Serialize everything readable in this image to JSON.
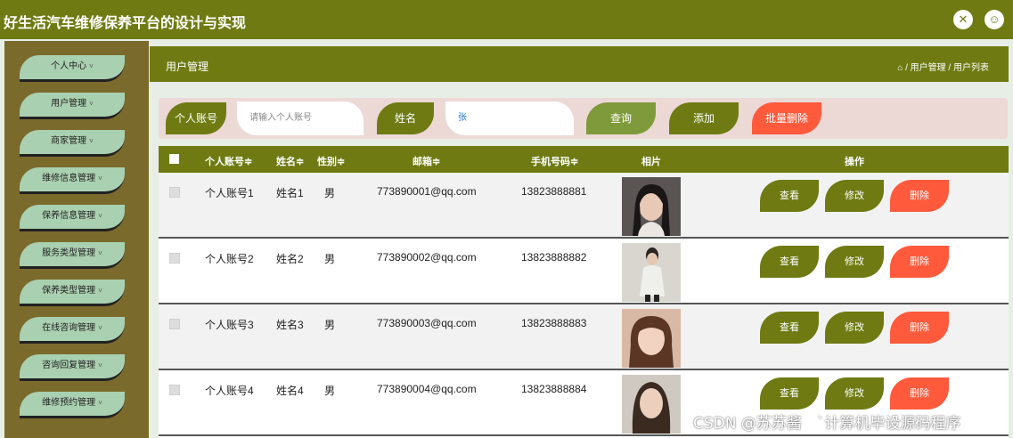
{
  "app": {
    "title": "好生活汽车维修保养平台的设计与实现"
  },
  "topbar": {
    "fullscreen_icon": "fullscreen-icon",
    "user_icon": "user-icon"
  },
  "sidebar": {
    "items": [
      {
        "label": "个人中心"
      },
      {
        "label": "用户管理"
      },
      {
        "label": "商家管理"
      },
      {
        "label": "维修信息管理"
      },
      {
        "label": "保养信息管理"
      },
      {
        "label": "服务类型管理"
      },
      {
        "label": "保养类型管理"
      },
      {
        "label": "在线咨询管理"
      },
      {
        "label": "咨询回复管理"
      },
      {
        "label": "维修预约管理"
      }
    ],
    "chevron": "˅"
  },
  "header": {
    "title": "用户管理",
    "breadcrumb": "⌂ / 用户管理 / 用户列表"
  },
  "search": {
    "account_label": "个人账号",
    "account_placeholder": "请输入个人账号",
    "name_label": "姓名",
    "name_value": "张",
    "query_button": "查询",
    "add_button": "添加",
    "batch_delete_button": "批量删除"
  },
  "table": {
    "headers": [
      "个人账号≑",
      "姓名≑",
      "性别≑",
      "邮箱≑",
      "手机号码≑",
      "相片",
      "操作"
    ],
    "rows": [
      {
        "account": "个人账号1",
        "name": "姓名1",
        "gender": "男",
        "email": "773890001@qq.com",
        "phone": "13823888881"
      },
      {
        "account": "个人账号2",
        "name": "姓名2",
        "gender": "男",
        "email": "773890002@qq.com",
        "phone": "13823888882"
      },
      {
        "account": "个人账号3",
        "name": "姓名3",
        "gender": "男",
        "email": "773890003@qq.com",
        "phone": "13823888883"
      },
      {
        "account": "个人账号4",
        "name": "姓名4",
        "gender": "男",
        "email": "773890004@qq.com",
        "phone": "13823888884"
      }
    ],
    "actions": {
      "view": "查看",
      "edit": "修改",
      "delete": "删除"
    }
  },
  "watermark": "CSDN @苏苏酱　`计算机毕设源码程序",
  "colors": {
    "primary": "#6f7b12",
    "sidebar": "#7a6a2c",
    "menu": "#a9d0b0",
    "danger": "#ff5a3c",
    "search_bg": "#ecd9d6"
  }
}
